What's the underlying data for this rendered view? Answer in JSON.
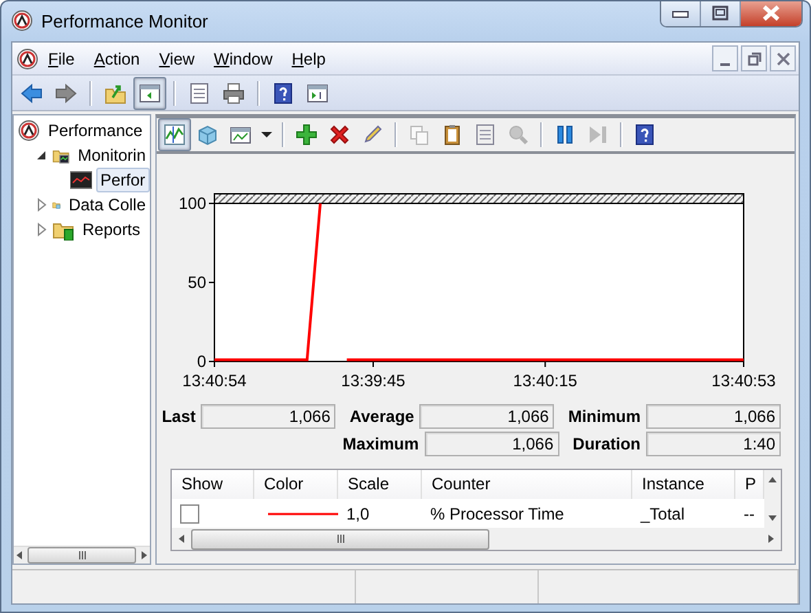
{
  "window": {
    "title": "Performance Monitor"
  },
  "menu": [
    {
      "label": "File"
    },
    {
      "label": "Action"
    },
    {
      "label": "View"
    },
    {
      "label": "Window"
    },
    {
      "label": "Help"
    }
  ],
  "toolbar": [
    {
      "kind": "button",
      "pressed": false,
      "disabled": false
    },
    {
      "kind": "button",
      "pressed": false,
      "disabled": false
    },
    {
      "kind": "separator"
    },
    {
      "kind": "button",
      "pressed": false,
      "disabled": false
    },
    {
      "kind": "button",
      "pressed": true,
      "disabled": false
    },
    {
      "kind": "separator"
    },
    {
      "kind": "button",
      "pressed": false,
      "disabled": false
    },
    {
      "kind": "button",
      "pressed": false,
      "disabled": false
    },
    {
      "kind": "separator"
    },
    {
      "kind": "button",
      "pressed": false,
      "disabled": false
    },
    {
      "kind": "button",
      "pressed": false,
      "disabled": false
    }
  ],
  "tree": [
    {
      "label": "Performance",
      "children": [
        {
          "label": "Monitorin",
          "expanded": true,
          "children": [
            {
              "label": "Perfor",
              "selected": true
            }
          ]
        },
        {
          "label": "Data Colle",
          "expanded": false,
          "selected": false
        },
        {
          "label": "Reports",
          "expanded": false,
          "selected": false
        }
      ]
    }
  ],
  "graph_toolbar": [
    {
      "kind": "button",
      "pressed": true,
      "disabled": false
    },
    {
      "kind": "button",
      "pressed": false,
      "disabled": false
    },
    {
      "kind": "button",
      "pressed": false,
      "disabled": false
    },
    {
      "kind": "dropdown"
    },
    {
      "kind": "separator"
    },
    {
      "kind": "button",
      "pressed": false,
      "disabled": false
    },
    {
      "kind": "button",
      "pressed": false,
      "disabled": false
    },
    {
      "kind": "button",
      "pressed": false,
      "disabled": false
    },
    {
      "kind": "separator"
    },
    {
      "kind": "button",
      "pressed": false,
      "disabled": true
    },
    {
      "kind": "button",
      "pressed": false,
      "disabled": false
    },
    {
      "kind": "button",
      "pressed": false,
      "disabled": false
    },
    {
      "kind": "button",
      "pressed": false,
      "disabled": true
    },
    {
      "kind": "separator"
    },
    {
      "kind": "button",
      "pressed": false,
      "disabled": false
    },
    {
      "kind": "button",
      "pressed": false,
      "disabled": true
    },
    {
      "kind": "separator"
    },
    {
      "kind": "button",
      "pressed": false,
      "disabled": false
    }
  ],
  "graph": {
    "chart_data": {
      "type": "line",
      "ylim": [
        0,
        100
      ],
      "yticks": [
        0,
        50,
        100
      ],
      "categories": [
        "13:40:54",
        null,
        null,
        null,
        null,
        null,
        null,
        null,
        null,
        null,
        null,
        null,
        "13:39:45",
        null,
        null,
        null,
        null,
        null,
        null,
        null,
        null,
        null,
        null,
        null,
        null,
        "13:40:15",
        null,
        null,
        null,
        null,
        null,
        null,
        null,
        null,
        null,
        null,
        null,
        null,
        null,
        null,
        "13:40:53"
      ],
      "series": [
        {
          "color": "#ff0000",
          "values": [
            1,
            1,
            1,
            1,
            1,
            1,
            1,
            1,
            100,
            null,
            1,
            1,
            1,
            1,
            1,
            1,
            1,
            1,
            1,
            1,
            1,
            1,
            1,
            1,
            1,
            1,
            1,
            1,
            1,
            1,
            1,
            1,
            1,
            1,
            1,
            1,
            1,
            1,
            1,
            1,
            1
          ]
        }
      ]
    }
  },
  "stats": [
    [
      {
        "label": "Last",
        "value": "1,066"
      },
      {
        "label": "Average",
        "value": "1,066"
      },
      {
        "label": "Minimum",
        "value": "1,066"
      }
    ],
    [
      {
        "label": "Maximum",
        "value": "1,066"
      },
      {
        "label": "Duration",
        "value": "1:40"
      }
    ]
  ],
  "counters": {
    "columns": [
      "Show",
      "Color",
      "Scale",
      "Counter",
      "Instance",
      "P"
    ],
    "rows": [
      {
        "show": false,
        "color": "#ff0000",
        "scale": "1,0",
        "counter": "% Processor Time",
        "instance": "_Total",
        "column_6": "--"
      }
    ]
  }
}
